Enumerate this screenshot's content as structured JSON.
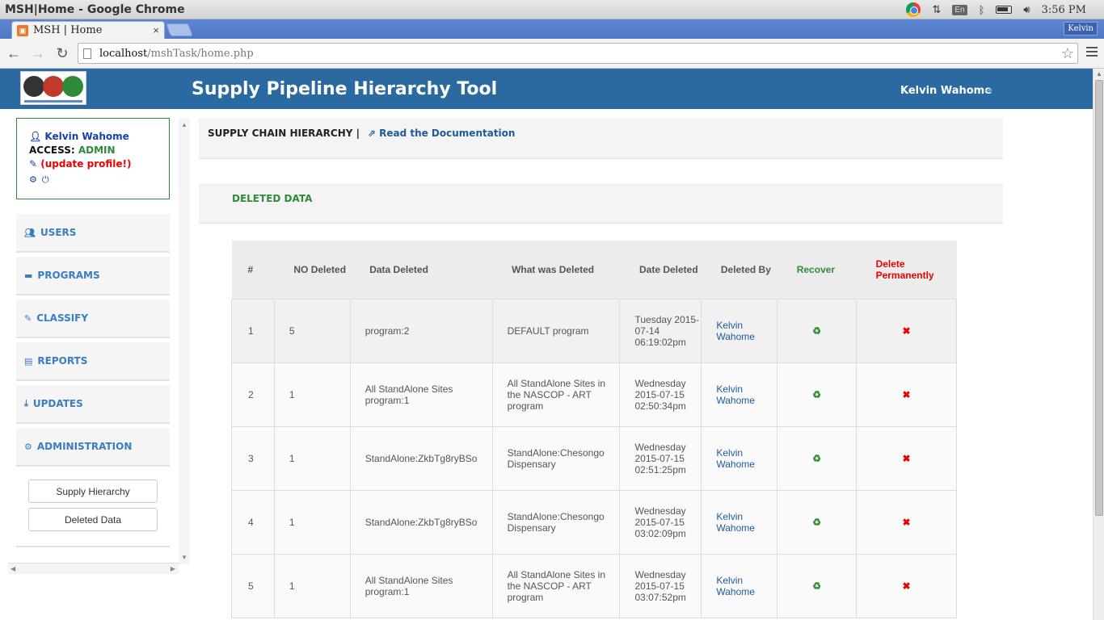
{
  "os": {
    "window_title": "MSH|Home - Google Chrome",
    "lang": "En",
    "time": "3:56 PM"
  },
  "browser": {
    "tab_title": "MSH | Home",
    "tab_close": "×",
    "profile": "Kelvin",
    "url_host": "localhost",
    "url_path": "/mshTask/home.php"
  },
  "header": {
    "title": "Supply Pipeline Hierarchy Tool",
    "user": "Kelvin Wahome"
  },
  "profile_box": {
    "name": "Kelvin Wahome",
    "access_label": "ACCESS:",
    "access_value": "ADMIN",
    "update_link": "(update profile!)"
  },
  "sidebar": {
    "items": [
      {
        "label": "USERS",
        "icon": "users-icon"
      },
      {
        "label": "PROGRAMS",
        "icon": "briefcase-icon"
      },
      {
        "label": "CLASSIFY",
        "icon": "edit-icon"
      },
      {
        "label": "REPORTS",
        "icon": "report-icon"
      },
      {
        "label": "UPDATES",
        "icon": "download-icon"
      },
      {
        "label": "ADMINISTRATION",
        "icon": "cogs-icon"
      }
    ],
    "admin_sub": [
      "Supply Hierarchy",
      "Deleted Data"
    ]
  },
  "breadcrumb": {
    "current": "SUPPLY CHAIN HIERARCHY |",
    "doc_link": "Read the Documentation"
  },
  "section_title": "DELETED DATA",
  "table": {
    "headers": [
      "#",
      "NO Deleted",
      "Data Deleted",
      "What was Deleted",
      "Date Deleted",
      "Deleted By",
      "Recover",
      "Delete Permanently"
    ],
    "rows": [
      {
        "n": "1",
        "count": "5",
        "data": "program:2",
        "what": "DEFAULT program",
        "date": "Tuesday 2015-07-14 06:19:02pm",
        "by": "Kelvin Wahome"
      },
      {
        "n": "2",
        "count": "1",
        "data": "All StandAlone Sites program:1",
        "what": "All StandAlone Sites in the NASCOP - ART program",
        "date": "Wednesday 2015-07-15 02:50:34pm",
        "by": "Kelvin Wahome"
      },
      {
        "n": "3",
        "count": "1",
        "data": "StandAlone:ZkbTg8ryBSo",
        "what": "StandAlone:Chesongo Dispensary",
        "date": "Wednesday 2015-07-15 02:51:25pm",
        "by": "Kelvin Wahome"
      },
      {
        "n": "4",
        "count": "1",
        "data": "StandAlone:ZkbTg8ryBSo",
        "what": "StandAlone:Chesongo Dispensary",
        "date": "Wednesday 2015-07-15 03:02:09pm",
        "by": "Kelvin Wahome"
      },
      {
        "n": "5",
        "count": "1",
        "data": "All StandAlone Sites program:1",
        "what": "All StandAlone Sites in the NASCOP - ART program",
        "date": "Wednesday 2015-07-15 03:07:52pm",
        "by": "Kelvin Wahome"
      }
    ]
  },
  "colors": {
    "header_blue": "#2b6aa0",
    "link_blue": "#1e5a9a",
    "green": "#2e8b3a",
    "red": "#e00"
  }
}
